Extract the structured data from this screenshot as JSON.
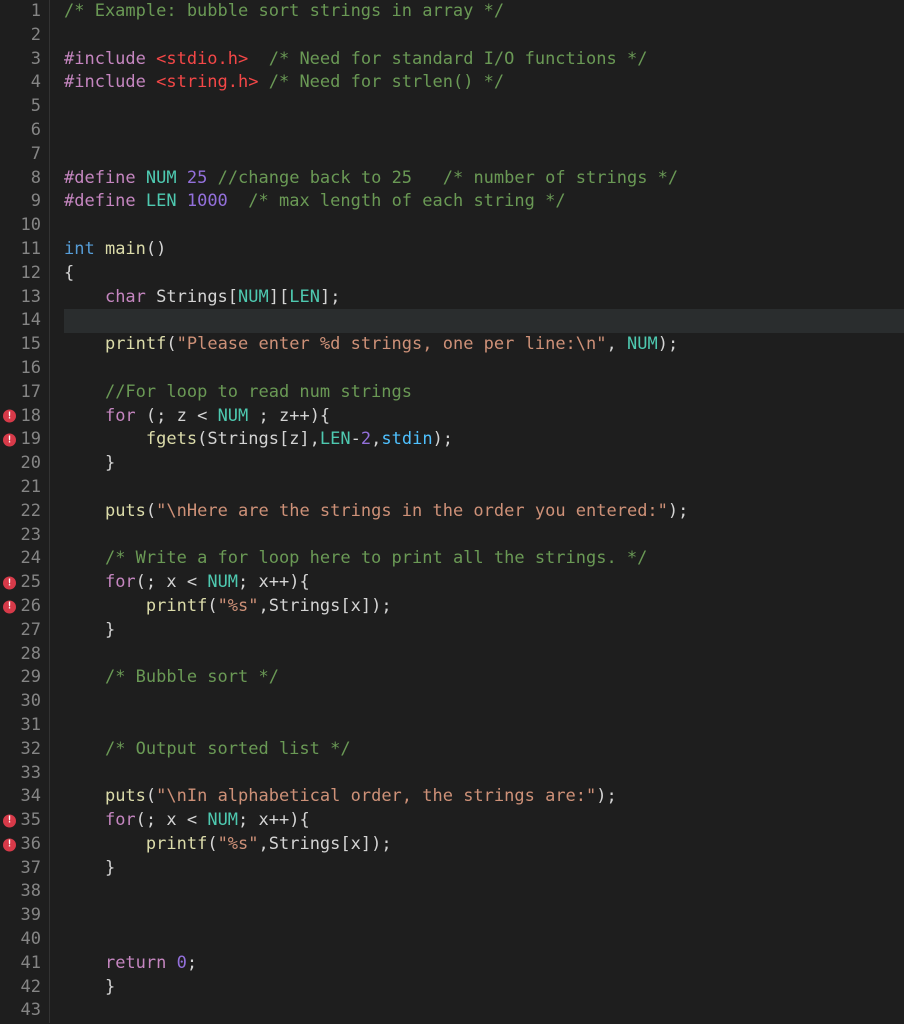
{
  "lines": [
    {
      "num": 1,
      "error": false,
      "tokens": [
        [
          "tok-comment",
          "/* Example: bubble sort strings in array */"
        ]
      ]
    },
    {
      "num": 2,
      "error": false,
      "tokens": []
    },
    {
      "num": 3,
      "error": false,
      "tokens": [
        [
          "tok-pink",
          "#include "
        ],
        [
          "tok-red",
          "<stdio.h>"
        ],
        [
          "tok-default",
          "  "
        ],
        [
          "tok-comment",
          "/* Need for standard I/O functions */"
        ]
      ]
    },
    {
      "num": 4,
      "error": false,
      "tokens": [
        [
          "tok-pink",
          "#include "
        ],
        [
          "tok-red",
          "<string.h>"
        ],
        [
          "tok-default",
          " "
        ],
        [
          "tok-comment",
          "/* Need for strlen() */"
        ]
      ]
    },
    {
      "num": 5,
      "error": false,
      "tokens": []
    },
    {
      "num": 6,
      "error": false,
      "tokens": []
    },
    {
      "num": 7,
      "error": false,
      "tokens": []
    },
    {
      "num": 8,
      "error": false,
      "tokens": [
        [
          "tok-pink",
          "#define "
        ],
        [
          "tok-fn",
          "NUM "
        ],
        [
          "tok-purple",
          "25"
        ],
        [
          "tok-default",
          " "
        ],
        [
          "tok-comment",
          "//change back to 25   /* number of strings */"
        ]
      ]
    },
    {
      "num": 9,
      "error": false,
      "tokens": [
        [
          "tok-pink",
          "#define "
        ],
        [
          "tok-fn",
          "LEN "
        ],
        [
          "tok-purple",
          "1000"
        ],
        [
          "tok-default",
          "  "
        ],
        [
          "tok-comment",
          "/* max length of each string */"
        ]
      ]
    },
    {
      "num": 10,
      "error": false,
      "tokens": []
    },
    {
      "num": 11,
      "error": false,
      "tokens": [
        [
          "tok-type",
          "int "
        ],
        [
          "tok-yellow",
          "main"
        ],
        [
          "tok-default",
          "()"
        ]
      ]
    },
    {
      "num": 12,
      "error": false,
      "tokens": [
        [
          "tok-default",
          "{"
        ]
      ]
    },
    {
      "num": 13,
      "error": false,
      "tokens": [
        [
          "tok-default",
          "    "
        ],
        [
          "tok-kw",
          "char"
        ],
        [
          "tok-default",
          " Strings["
        ],
        [
          "tok-fn",
          "NUM"
        ],
        [
          "tok-default",
          "]["
        ],
        [
          "tok-fn",
          "LEN"
        ],
        [
          "tok-default",
          "];"
        ]
      ]
    },
    {
      "num": 14,
      "error": false,
      "highlight": true,
      "tokens": []
    },
    {
      "num": 15,
      "error": false,
      "tokens": [
        [
          "tok-default",
          "    "
        ],
        [
          "tok-yellow",
          "printf"
        ],
        [
          "tok-default",
          "("
        ],
        [
          "tok-string",
          "\"Please enter %d strings, one per line:\\n\""
        ],
        [
          "tok-default",
          ", "
        ],
        [
          "tok-fn",
          "NUM"
        ],
        [
          "tok-default",
          ");"
        ]
      ]
    },
    {
      "num": 16,
      "error": false,
      "tokens": []
    },
    {
      "num": 17,
      "error": false,
      "tokens": [
        [
          "tok-default",
          "    "
        ],
        [
          "tok-comment",
          "//For loop to read num strings"
        ]
      ]
    },
    {
      "num": 18,
      "error": true,
      "tokens": [
        [
          "tok-default",
          "    "
        ],
        [
          "tok-kw",
          "for"
        ],
        [
          "tok-default",
          " (; z < "
        ],
        [
          "tok-fn",
          "NUM"
        ],
        [
          "tok-default",
          " ; z++){"
        ]
      ]
    },
    {
      "num": 19,
      "error": true,
      "tokens": [
        [
          "tok-default",
          "        "
        ],
        [
          "tok-yellow",
          "fgets"
        ],
        [
          "tok-default",
          "(Strings[z],"
        ],
        [
          "tok-fn",
          "LEN"
        ],
        [
          "tok-default",
          "-"
        ],
        [
          "tok-purple",
          "2"
        ],
        [
          "tok-default",
          ","
        ],
        [
          "tok-const",
          "stdin"
        ],
        [
          "tok-default",
          ");"
        ]
      ]
    },
    {
      "num": 20,
      "error": false,
      "tokens": [
        [
          "tok-default",
          "    }"
        ]
      ]
    },
    {
      "num": 21,
      "error": false,
      "tokens": []
    },
    {
      "num": 22,
      "error": false,
      "tokens": [
        [
          "tok-default",
          "    "
        ],
        [
          "tok-yellow",
          "puts"
        ],
        [
          "tok-default",
          "("
        ],
        [
          "tok-string",
          "\"\\nHere are the strings in the order you entered:\""
        ],
        [
          "tok-default",
          ");"
        ]
      ]
    },
    {
      "num": 23,
      "error": false,
      "tokens": []
    },
    {
      "num": 24,
      "error": false,
      "tokens": [
        [
          "tok-default",
          "    "
        ],
        [
          "tok-comment",
          "/* Write a for loop here to print all the strings. */"
        ]
      ]
    },
    {
      "num": 25,
      "error": true,
      "tokens": [
        [
          "tok-default",
          "    "
        ],
        [
          "tok-kw",
          "for"
        ],
        [
          "tok-default",
          "(; x < "
        ],
        [
          "tok-fn",
          "NUM"
        ],
        [
          "tok-default",
          "; x++){"
        ]
      ]
    },
    {
      "num": 26,
      "error": true,
      "tokens": [
        [
          "tok-default",
          "        "
        ],
        [
          "tok-yellow",
          "printf"
        ],
        [
          "tok-default",
          "("
        ],
        [
          "tok-string",
          "\"%s\""
        ],
        [
          "tok-default",
          ",Strings[x]);"
        ]
      ]
    },
    {
      "num": 27,
      "error": false,
      "tokens": [
        [
          "tok-default",
          "    }"
        ]
      ]
    },
    {
      "num": 28,
      "error": false,
      "tokens": []
    },
    {
      "num": 29,
      "error": false,
      "tokens": [
        [
          "tok-default",
          "    "
        ],
        [
          "tok-comment",
          "/* Bubble sort */"
        ]
      ]
    },
    {
      "num": 30,
      "error": false,
      "tokens": []
    },
    {
      "num": 31,
      "error": false,
      "tokens": []
    },
    {
      "num": 32,
      "error": false,
      "tokens": [
        [
          "tok-default",
          "    "
        ],
        [
          "tok-comment",
          "/* Output sorted list */"
        ]
      ]
    },
    {
      "num": 33,
      "error": false,
      "tokens": []
    },
    {
      "num": 34,
      "error": false,
      "tokens": [
        [
          "tok-default",
          "    "
        ],
        [
          "tok-yellow",
          "puts"
        ],
        [
          "tok-default",
          "("
        ],
        [
          "tok-string",
          "\"\\nIn alphabetical order, the strings are:\""
        ],
        [
          "tok-default",
          ");"
        ]
      ]
    },
    {
      "num": 35,
      "error": true,
      "tokens": [
        [
          "tok-default",
          "    "
        ],
        [
          "tok-kw",
          "for"
        ],
        [
          "tok-default",
          "(; x < "
        ],
        [
          "tok-fn",
          "NUM"
        ],
        [
          "tok-default",
          "; x++){"
        ]
      ]
    },
    {
      "num": 36,
      "error": true,
      "tokens": [
        [
          "tok-default",
          "        "
        ],
        [
          "tok-yellow",
          "printf"
        ],
        [
          "tok-default",
          "("
        ],
        [
          "tok-string",
          "\"%s\""
        ],
        [
          "tok-default",
          ",Strings[x]);"
        ]
      ]
    },
    {
      "num": 37,
      "error": false,
      "tokens": [
        [
          "tok-default",
          "    }"
        ]
      ]
    },
    {
      "num": 38,
      "error": false,
      "tokens": []
    },
    {
      "num": 39,
      "error": false,
      "tokens": []
    },
    {
      "num": 40,
      "error": false,
      "tokens": []
    },
    {
      "num": 41,
      "error": false,
      "tokens": [
        [
          "tok-default",
          "    "
        ],
        [
          "tok-kw",
          "return"
        ],
        [
          "tok-default",
          " "
        ],
        [
          "tok-purple",
          "0"
        ],
        [
          "tok-default",
          ";"
        ]
      ]
    },
    {
      "num": 42,
      "error": false,
      "tokens": [
        [
          "tok-default",
          "    }"
        ]
      ]
    },
    {
      "num": 43,
      "error": false,
      "tokens": []
    }
  ]
}
